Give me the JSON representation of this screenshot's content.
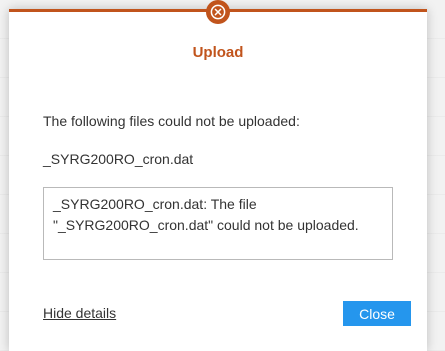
{
  "dialog": {
    "title": "Upload",
    "message": "The following files could not be uploaded:",
    "file_name": "_SYRG200RO_cron.dat",
    "details": "_SYRG200RO_cron.dat: The file \"_SYRG200RO_cron.dat\" could not be uploaded.",
    "hide_details_label": "Hide details",
    "close_label": "Close",
    "close_icon": "close-x-circle-icon"
  },
  "colors": {
    "accent": "#c1541c",
    "button": "#2596ed",
    "text": "#333333"
  }
}
